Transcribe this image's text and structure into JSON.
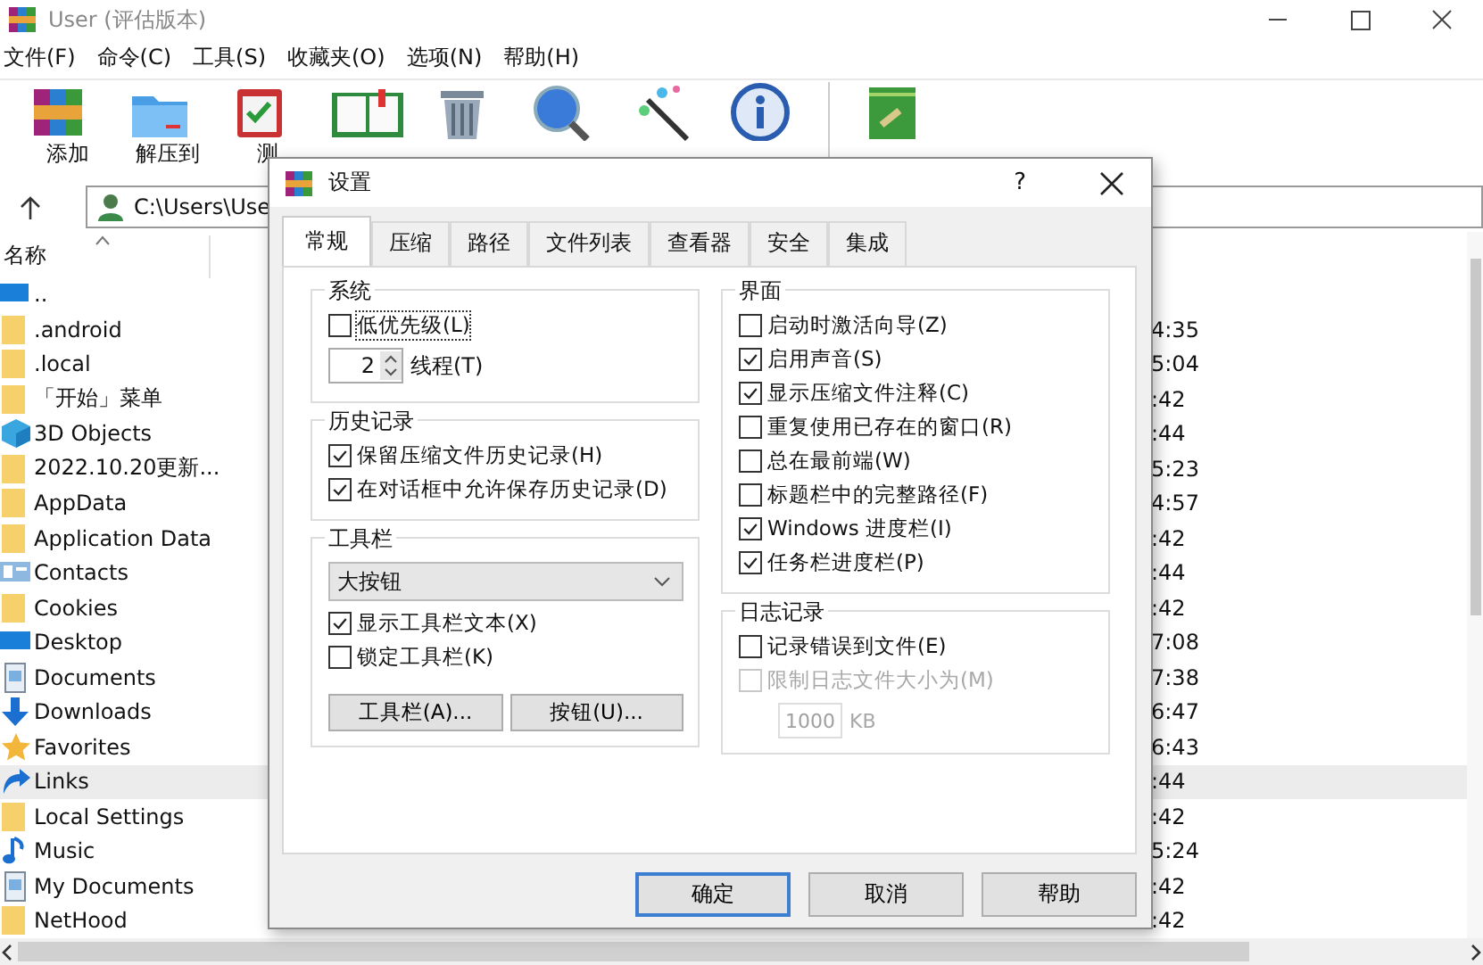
{
  "window": {
    "title": "User (评估版本)"
  },
  "menu": [
    "文件(F)",
    "命令(C)",
    "工具(S)",
    "收藏夹(O)",
    "选项(N)",
    "帮助(H)"
  ],
  "toolbar": [
    {
      "kind": "add",
      "label": "添加"
    },
    {
      "kind": "extract",
      "label": "解压到"
    },
    {
      "kind": "test",
      "label": "测"
    },
    {
      "kind": "view"
    },
    {
      "kind": "delete"
    },
    {
      "kind": "find"
    },
    {
      "kind": "wizard"
    },
    {
      "kind": "info"
    },
    {
      "kind": "separator"
    },
    {
      "kind": "repair"
    }
  ],
  "address": {
    "path": "C:\\Users\\Use"
  },
  "file_list": {
    "columns": [
      "名称"
    ],
    "rows": [
      {
        "kind": "up",
        "name": "..",
        "selected": false
      },
      {
        "kind": "folder",
        "name": ".android",
        "column_2": "4:35",
        "selected": false
      },
      {
        "kind": "folder",
        "name": ".local",
        "column_2": "5:04",
        "selected": false
      },
      {
        "kind": "folder",
        "name": "「开始」菜单",
        "column_2": ":42",
        "selected": false
      },
      {
        "kind": "objects3d",
        "name": "3D Objects",
        "column_2": ":44",
        "selected": false
      },
      {
        "kind": "folder",
        "name": "2022.10.20更新...",
        "column_2": "5:23",
        "selected": false
      },
      {
        "kind": "folder",
        "name": "AppData",
        "column_2": "4:57",
        "selected": false
      },
      {
        "kind": "folder",
        "name": "Application Data",
        "column_2": ":42",
        "selected": false
      },
      {
        "kind": "contacts",
        "name": "Contacts",
        "column_2": ":44",
        "selected": false
      },
      {
        "kind": "folder",
        "name": "Cookies",
        "column_2": ":42",
        "selected": false
      },
      {
        "kind": "desktop",
        "name": "Desktop",
        "column_2": "7:08",
        "selected": false
      },
      {
        "kind": "documents",
        "name": "Documents",
        "column_2": "7:38",
        "selected": false
      },
      {
        "kind": "downloads",
        "name": "Downloads",
        "column_2": "6:47",
        "selected": false
      },
      {
        "kind": "favorites",
        "name": "Favorites",
        "column_2": "6:43",
        "selected": false
      },
      {
        "kind": "links",
        "name": "Links",
        "column_2": ":44",
        "selected": true
      },
      {
        "kind": "folder",
        "name": "Local Settings",
        "column_2": ":42",
        "selected": false
      },
      {
        "kind": "music",
        "name": "Music",
        "column_2": "5:24",
        "selected": false
      },
      {
        "kind": "documents",
        "name": "My Documents",
        "column_2": ":42",
        "selected": false
      },
      {
        "kind": "folder",
        "name": "NetHood",
        "column_2": ":42",
        "selected": false
      }
    ]
  },
  "dialog": {
    "title": "设置",
    "help": "?",
    "tabs": [
      {
        "label": "常规",
        "selected": true
      },
      {
        "label": "压缩",
        "selected": false
      },
      {
        "label": "路径",
        "selected": false
      },
      {
        "label": "文件列表",
        "selected": false
      },
      {
        "label": "查看器",
        "selected": false
      },
      {
        "label": "安全",
        "selected": false
      },
      {
        "label": "集成",
        "selected": false
      }
    ],
    "columns": [
      [
        {
          "title": "系统",
          "items": [
            {
              "kind": "checkbox",
              "label": "低优先级(L)",
              "checked": false,
              "focused": true,
              "disabled": false
            },
            {
              "kind": "spinner",
              "value": "2",
              "label": "线程(T)"
            }
          ]
        },
        {
          "title": "历史记录",
          "items": [
            {
              "kind": "checkbox",
              "label": "保留压缩文件历史记录(H)",
              "checked": true,
              "focused": false,
              "disabled": false
            },
            {
              "kind": "checkbox",
              "label": "在对话框中允许保存历史记录(D)",
              "checked": true,
              "focused": false,
              "disabled": false
            }
          ]
        },
        {
          "title": "工具栏",
          "items": [
            {
              "kind": "dropdown",
              "value": "大按钮"
            },
            {
              "kind": "checkbox",
              "label": "显示工具栏文本(X)",
              "checked": true,
              "focused": false,
              "disabled": false
            },
            {
              "kind": "checkbox",
              "label": "锁定工具栏(K)",
              "checked": false,
              "focused": false,
              "disabled": false
            },
            {
              "kind": "buttons",
              "labels": [
                "工具栏(A)...",
                "按钮(U)..."
              ]
            }
          ]
        }
      ],
      [
        {
          "title": "界面",
          "items": [
            {
              "kind": "checkbox",
              "label": "启动时激活向导(Z)",
              "checked": false,
              "focused": false,
              "disabled": false
            },
            {
              "kind": "checkbox",
              "label": "启用声音(S)",
              "checked": true,
              "focused": false,
              "disabled": false
            },
            {
              "kind": "checkbox",
              "label": "显示压缩文件注释(C)",
              "checked": true,
              "focused": false,
              "disabled": false
            },
            {
              "kind": "checkbox",
              "label": "重复使用已存在的窗口(R)",
              "checked": false,
              "focused": false,
              "disabled": false
            },
            {
              "kind": "checkbox",
              "label": "总在最前端(W)",
              "checked": false,
              "focused": false,
              "disabled": false
            },
            {
              "kind": "checkbox",
              "label": "标题栏中的完整路径(F)",
              "checked": false,
              "focused": false,
              "disabled": false
            },
            {
              "kind": "checkbox",
              "label": "Windows 进度栏(I)",
              "checked": true,
              "focused": false,
              "disabled": false
            },
            {
              "kind": "checkbox",
              "label": "任务栏进度栏(P)",
              "checked": true,
              "focused": false,
              "disabled": false
            }
          ]
        },
        {
          "title": "日志记录",
          "items": [
            {
              "kind": "checkbox",
              "label": "记录错误到文件(E)",
              "checked": false,
              "focused": false,
              "disabled": false
            },
            {
              "kind": "checkbox",
              "label": "限制日志文件大小为(M)",
              "checked": false,
              "focused": false,
              "disabled": true
            },
            {
              "kind": "sizefield",
              "value": "1000",
              "unit": "KB",
              "disabled": true
            }
          ]
        }
      ]
    ],
    "buttons": [
      {
        "label": "确定",
        "default": true
      },
      {
        "label": "取消",
        "default": false
      },
      {
        "label": "帮助",
        "default": false
      }
    ]
  }
}
